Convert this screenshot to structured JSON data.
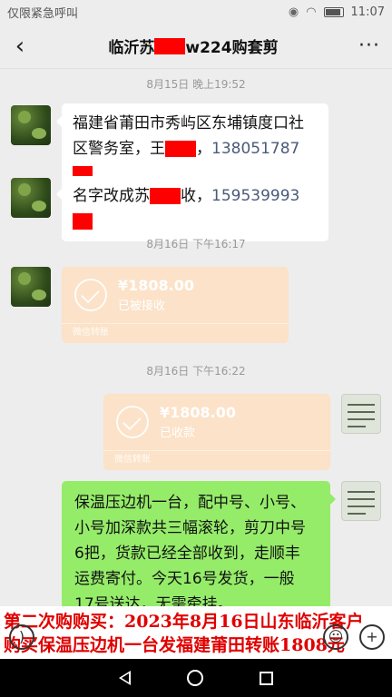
{
  "status_bar": {
    "carrier": "仅限紧急呼叫",
    "time": "11:07"
  },
  "nav": {
    "back_icon": "‹",
    "title_prefix": "临沂苏",
    "title_suffix": "w224购套剪",
    "more_icon": "···"
  },
  "messages": {
    "time1": "8月15日 晚上19:52",
    "msg1_line1": "福建省莆田市秀屿区东埔镇度口社",
    "msg1_line2_a": "区警务室，王",
    "msg1_line2_b": "，",
    "msg1_phone": "138051787",
    "msg2_a": "名字改成苏",
    "msg2_b": "收，",
    "msg2_phone": "159539993",
    "time2": "8月16日 下午16:17",
    "transfer1_amount": "¥1808.00",
    "transfer1_status": "已被接收",
    "transfer1_foot": "微信转账",
    "time3": "8月16日 下午16:22",
    "transfer2_amount": "¥1808.00",
    "transfer2_status": "已收款",
    "transfer2_foot": "微信转账",
    "msg3_lines": [
      "保温压边机一台，配中号、小号、",
      "小号加深款共三幅滚轮，剪刀中号",
      "6把，货款已经全部收到，走顺丰",
      "运费寄付。今天16号发货，一般",
      "17号送达，无需牵挂。"
    ]
  },
  "caption": {
    "line1": "第二次购购买：2023年8月16日山东临沂客户",
    "line2": "购买保温压边机一台发福建莆田转账1808元"
  },
  "colors": {
    "accent_green": "#95ec69",
    "transfer_orange": "#fbe2c8",
    "caption_red": "#e00000",
    "redact": "#ff0000"
  }
}
